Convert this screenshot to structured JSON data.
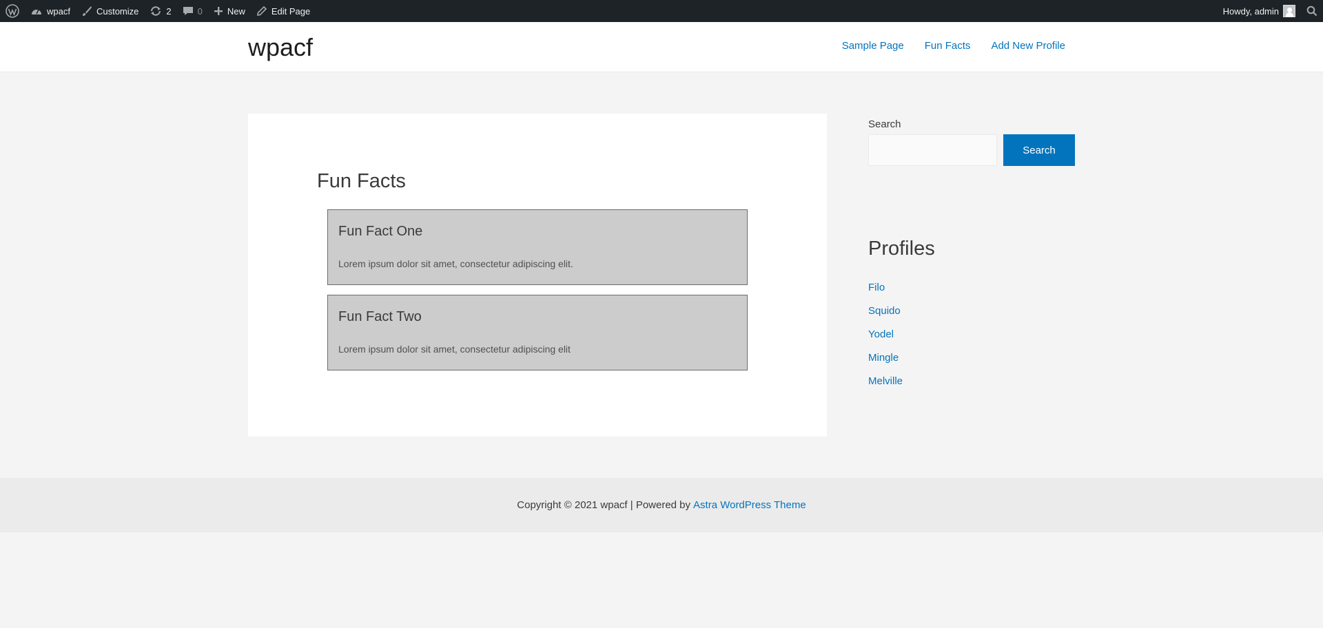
{
  "adminbar": {
    "wp_logo_icon": "wordpress-logo",
    "site_name": "wpacf",
    "customize": "Customize",
    "updates_count": "2",
    "comments_count": "0",
    "new_label": "New",
    "edit_page": "Edit Page",
    "howdy": "Howdy, admin"
  },
  "header": {
    "site_title": "wpacf",
    "nav": [
      "Sample Page",
      "Fun Facts",
      "Add New Profile"
    ]
  },
  "main": {
    "title": "Fun Facts",
    "facts": [
      {
        "title": "Fun Fact One",
        "text": "Lorem ipsum dolor sit amet, consectetur adipiscing elit."
      },
      {
        "title": "Fun Fact Two",
        "text": "Lorem ipsum dolor sit amet, consectetur adipiscing elit"
      }
    ]
  },
  "sidebar": {
    "search_label": "Search",
    "search_value": "",
    "search_button": "Search",
    "profiles_title": "Profiles",
    "profiles": [
      "Filo",
      "Squido",
      "Yodel",
      "Mingle",
      "Melville"
    ]
  },
  "footer": {
    "text": "Copyright © 2021 wpacf | Powered by",
    "link": "Astra WordPress Theme"
  },
  "colors": {
    "link": "#0274be",
    "adminbar_bg": "#1d2327",
    "fact_bg": "#cccccc"
  }
}
